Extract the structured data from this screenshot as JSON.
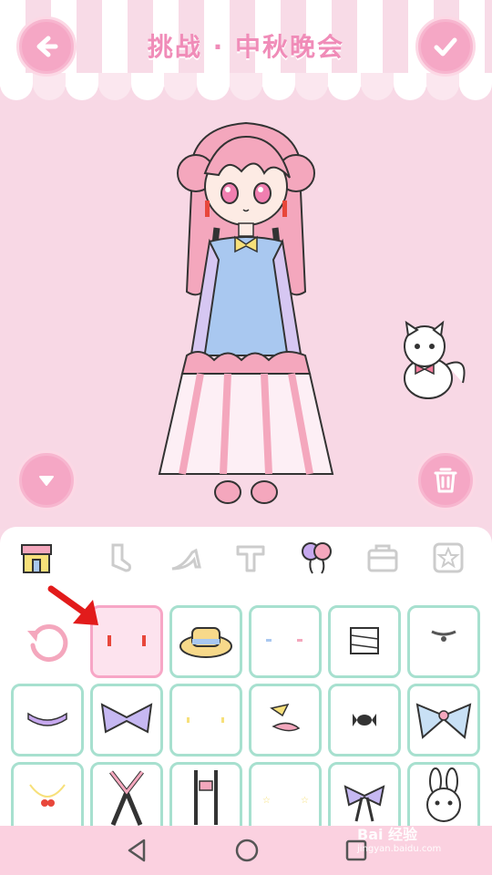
{
  "header": {
    "title": "挑战 · 中秋晚会",
    "back_icon": "arrow-left-icon",
    "confirm_icon": "checkmark-icon"
  },
  "stage": {
    "collapse_icon": "triangle-down-icon",
    "delete_icon": "trash-icon"
  },
  "categories": [
    {
      "name": "shop",
      "icon": "shop-icon"
    },
    {
      "name": "socks",
      "icon": "sock-icon"
    },
    {
      "name": "shoes",
      "icon": "high-heel-icon"
    },
    {
      "name": "top",
      "icon": "shirt-icon"
    },
    {
      "name": "accessories",
      "icon": "balloons-icon",
      "selected": true
    },
    {
      "name": "bag",
      "icon": "bag-icon"
    },
    {
      "name": "favorites",
      "icon": "star-icon"
    }
  ],
  "items": [
    {
      "icon": "earrings-red-icon",
      "selected": true
    },
    {
      "icon": "straw-hat-icon"
    },
    {
      "icon": "blue-earrings-icon"
    },
    {
      "icon": "bandage-icon"
    },
    {
      "icon": "choker-icon"
    },
    {
      "icon": "lace-collar-icon"
    },
    {
      "icon": "purple-bow-icon"
    },
    {
      "icon": "yellow-earrings-icon"
    },
    {
      "icon": "candy-hairclip-icon"
    },
    {
      "icon": "wrapped-candy-icon"
    },
    {
      "icon": "plaid-bow-icon"
    },
    {
      "icon": "cherry-necklace-icon"
    },
    {
      "icon": "pink-ribbon-icon"
    },
    {
      "icon": "suspenders-icon"
    },
    {
      "icon": "star-earrings-icon"
    },
    {
      "icon": "purple-ribbon-icon"
    },
    {
      "icon": "bunny-icon"
    }
  ],
  "reset_icon": "reset-icon",
  "watermark": {
    "brand": "Bai 经验",
    "url": "jingyan.baidu.com"
  },
  "colors": {
    "accent_pink": "#f5a7c5",
    "mint_border": "#a7e0cf",
    "background": "#f8d8e5"
  }
}
